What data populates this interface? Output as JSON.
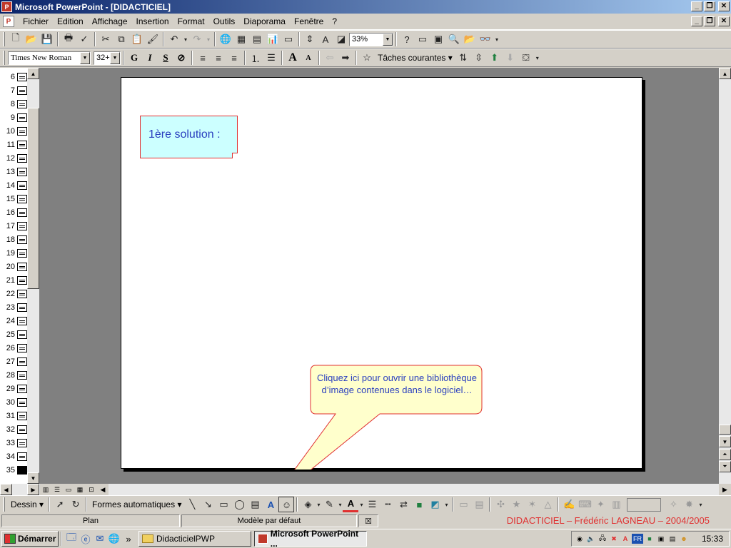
{
  "window": {
    "title": "Microsoft PowerPoint - [DIDACTICIEL]"
  },
  "menu": {
    "items": [
      {
        "label": "Fichier",
        "key": "F"
      },
      {
        "label": "Edition",
        "key": "E"
      },
      {
        "label": "Affichage",
        "key": "A"
      },
      {
        "label": "Insertion",
        "key": "I"
      },
      {
        "label": "Format",
        "key": "o"
      },
      {
        "label": "Outils",
        "key": "O"
      },
      {
        "label": "Diaporama",
        "key": "D"
      },
      {
        "label": "Fenêtre",
        "key": "n"
      },
      {
        "label": "?",
        "key": "?"
      }
    ]
  },
  "toolbar": {
    "zoom": "33%",
    "font": "Times New Roman",
    "font_size": "32+",
    "bold": "G",
    "italic": "I",
    "shadow": "S",
    "tasks_label": "Tâches courantes"
  },
  "outline": {
    "slides": [
      "6",
      "7",
      "8",
      "9",
      "10",
      "11",
      "12",
      "13",
      "14",
      "15",
      "16",
      "17",
      "18",
      "19",
      "20",
      "21",
      "22",
      "23",
      "24",
      "25",
      "26",
      "27",
      "28",
      "29",
      "30",
      "31",
      "32",
      "33",
      "34",
      "35"
    ],
    "selected": "35"
  },
  "slide": {
    "note_text": "1ère solution :",
    "callout_text": "Cliquez ici pour ouvrir une bibliothèque d’image contenues dans le logiciel…"
  },
  "drawbar": {
    "dessin": "Dessin",
    "formes": "Formes automatiques"
  },
  "status": {
    "view": "Plan",
    "template": "Modèle par défaut",
    "credit": "DIDACTICIEL – Frédéric LAGNEAU – 2004/2005"
  },
  "taskbar": {
    "start": "Démarrer",
    "tasks": [
      {
        "label": "DidacticielPWP"
      },
      {
        "label": "Microsoft PowerPoint ..."
      }
    ],
    "lang": "FR",
    "clock": "15:33"
  },
  "colors": {
    "title_gradient_start": "#0a246a",
    "note_fill": "#ccffff",
    "callout_fill": "#ffffcc",
    "accent_red": "#e03030",
    "text_blue": "#2a3fbf"
  }
}
